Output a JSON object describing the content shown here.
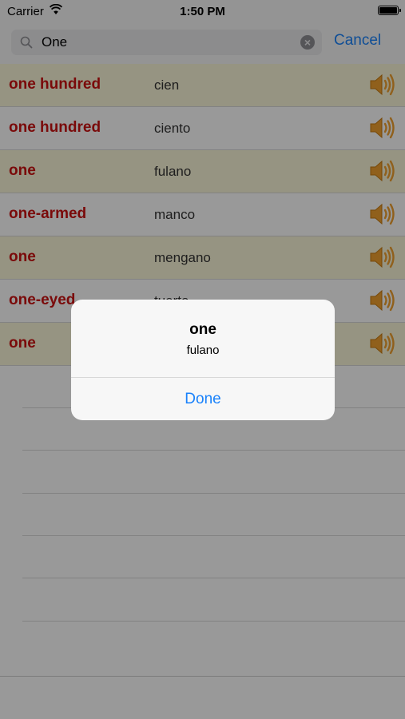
{
  "status_bar": {
    "carrier": "Carrier",
    "time": "1:50 PM"
  },
  "search": {
    "value": "One",
    "cancel_label": "Cancel"
  },
  "rows": [
    {
      "english": "one hundred",
      "spanish": "cien"
    },
    {
      "english": "one hundred",
      "spanish": "ciento"
    },
    {
      "english": "one",
      "spanish": "fulano"
    },
    {
      "english": "one-armed",
      "spanish": "manco"
    },
    {
      "english": "one",
      "spanish": "mengano"
    },
    {
      "english": "one-eyed",
      "spanish": "tuerto"
    },
    {
      "english": "one",
      "spanish": ""
    }
  ],
  "alert": {
    "title": "one",
    "message": "fulano",
    "button": "Done"
  },
  "colors": {
    "accent": "#1a82fb",
    "english_text": "#cc1111",
    "row_highlight": "#fbf7d9",
    "speaker": "#f0a030"
  }
}
